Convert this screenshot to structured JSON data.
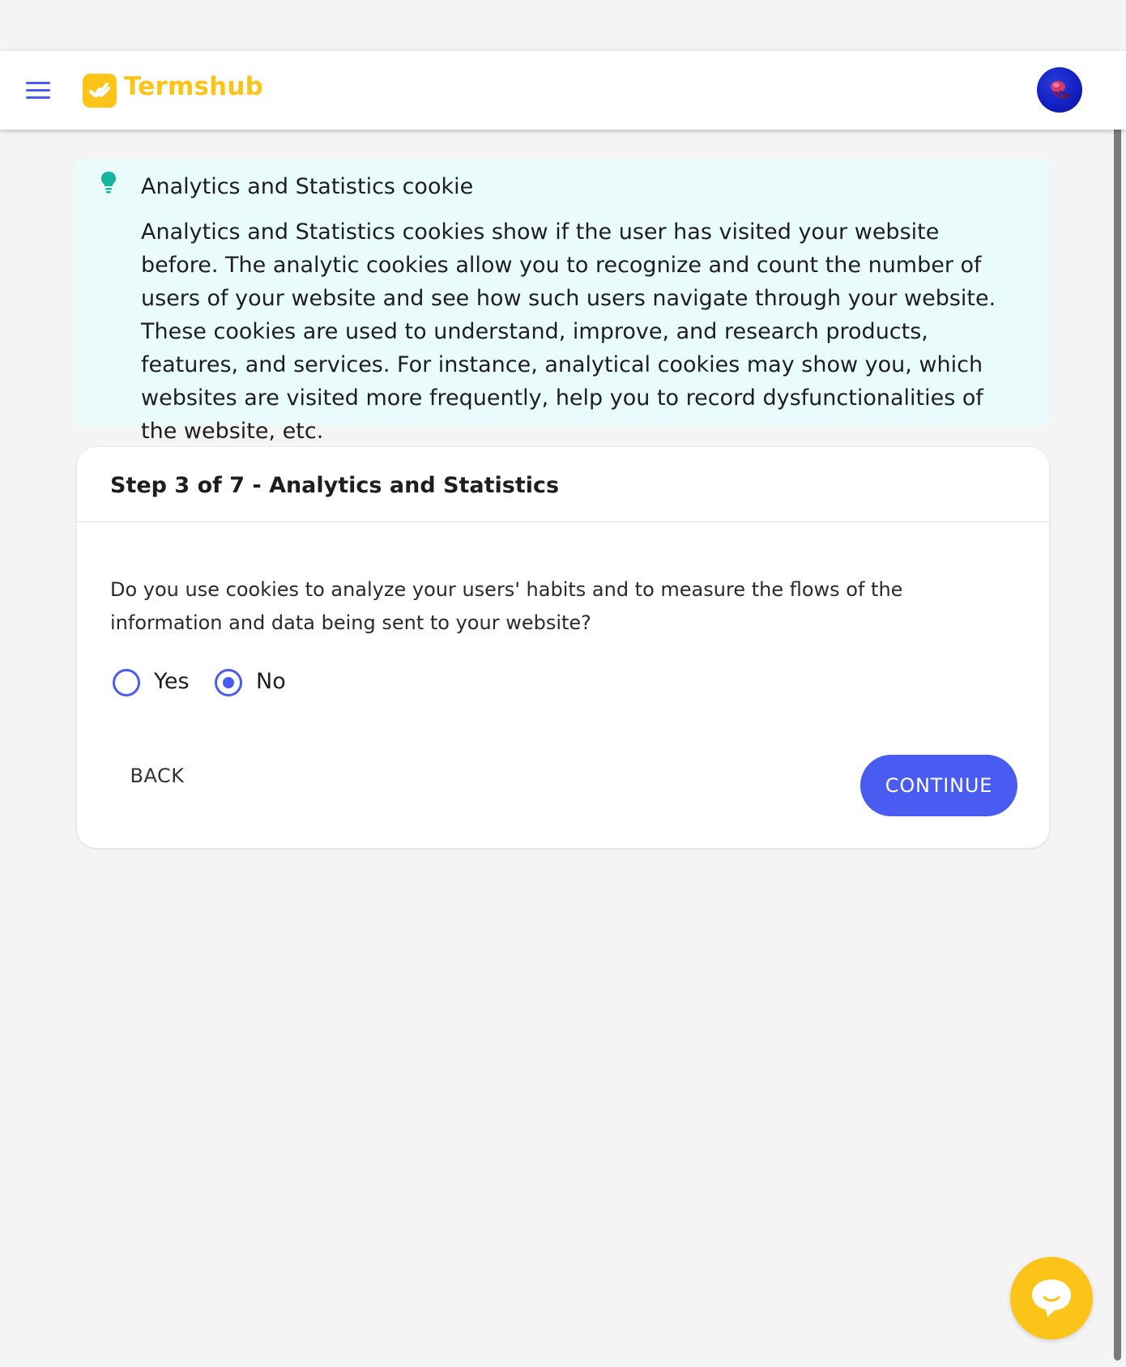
{
  "brand": {
    "name": "Termshub",
    "color": "#fcc419",
    "logo_icon": "checkmark-logo-icon"
  },
  "accent_color": "#4a5bf2",
  "header": {
    "menu_icon": "hamburger-menu-icon",
    "avatar_icon": "user-avatar"
  },
  "tip": {
    "icon": "lightbulb-icon",
    "title": "Analytics and Statistics cookie",
    "body": "Analytics and Statistics cookies show if the user has visited your website before. The analytic cookies allow you to recognize and count the number of users of your website and see how such users navigate through your website. These cookies are used to understand, improve, and research products, features, and services. For instance, analytical cookies may show you, which websites are visited more frequently, help you to record dysfunctionalities of the website, etc."
  },
  "step": {
    "title": "Step 3 of 7 - Analytics and Statistics",
    "question": "Do you use cookies to analyze your users' habits and to measure the flows of the information and data being sent to your website?",
    "options": [
      {
        "label": "Yes",
        "selected": false
      },
      {
        "label": "No",
        "selected": true
      }
    ],
    "back_label": "BACK",
    "continue_label": "CONTINUE"
  },
  "chat": {
    "icon": "chat-bubble-icon"
  }
}
